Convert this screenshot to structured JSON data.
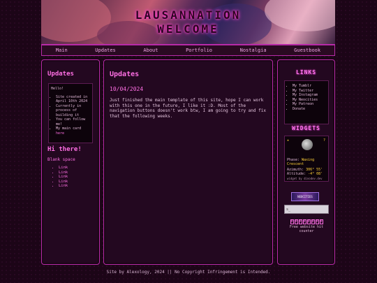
{
  "header": {
    "line1": "LAUSANNATION",
    "line2": "WELCOME"
  },
  "nav": [
    "Main",
    "Updates",
    "About",
    "Portfolio",
    "Nostalgia",
    "Guestbook"
  ],
  "left": {
    "title": "Updates",
    "notice_greeting": "Hello!",
    "notice_items": [
      "Site created in April 10th 2024",
      "Currently in process of building it",
      "You can follow me!"
    ],
    "notice_main_card": "My main card",
    "notice_here": "here",
    "hi": "Hi there!",
    "blank": "Blank space",
    "links": [
      "Link",
      "Link",
      "Link",
      "Link",
      "Link"
    ]
  },
  "main": {
    "title": "Updates",
    "date": "10/04/2024",
    "body": "Just finished the main template of this site, hope I can work with this one in the future, I like it :D. Most of the navigation buttons doesn't work btw, I am going to try and fix that the following weeks."
  },
  "right": {
    "links_title": "LINKS",
    "links": [
      "My Tumblr",
      "My Twitter",
      "My Instagram",
      "My Neocities",
      "My Patreon",
      "Donate"
    ],
    "widgets_title": "WIDGETS",
    "moon": {
      "phase_label": "Phase:",
      "phase_value": "Waxing Crescent",
      "azimuth_label": "Azimuth:",
      "azimuth_value": "306° 55'",
      "altitude_label": "Altitude:",
      "altitude_value": "-4° 08'",
      "credit": "widget by dinodev.dev",
      "star": "★",
      "question": "?"
    },
    "badge_text": "NEOCITIES",
    "search_placeholder": "s_",
    "counter_digits": [
      "0",
      "0",
      "0",
      "0",
      "0",
      "0",
      "0",
      "0"
    ],
    "counter_text": "Free website hit counter"
  },
  "footer": "Site by Alexology, 2024 || No Copyright Infringement is Intended."
}
